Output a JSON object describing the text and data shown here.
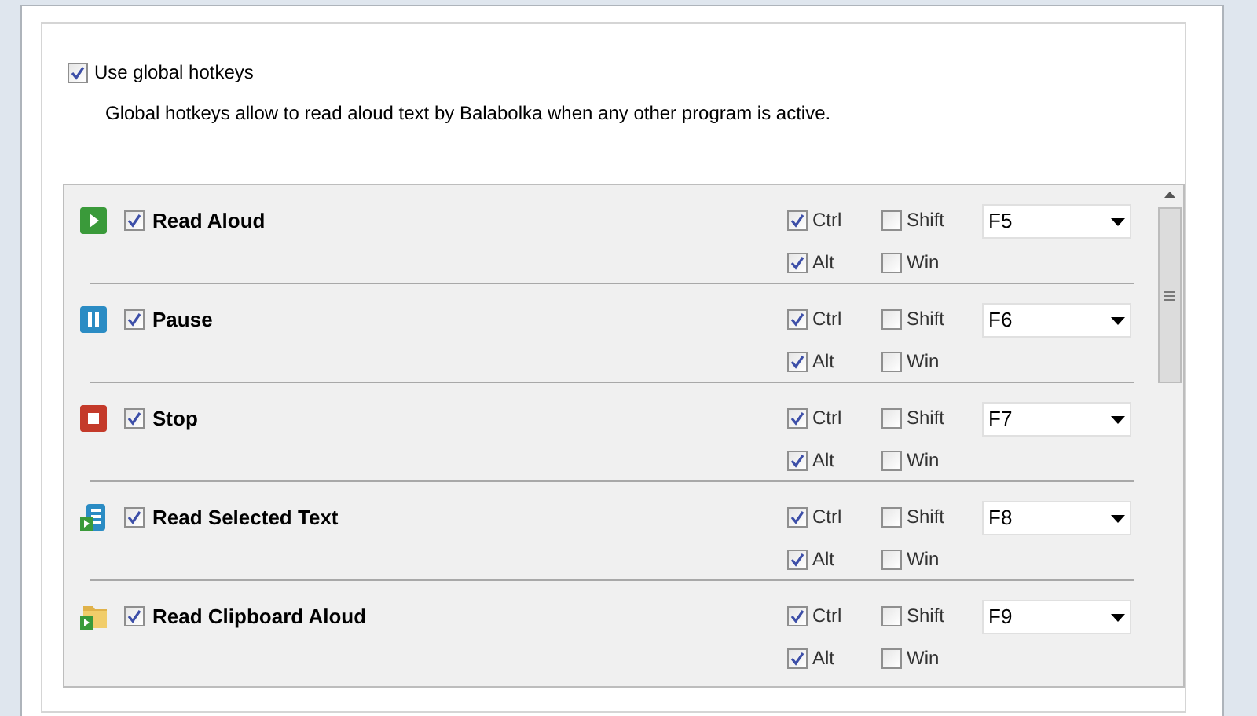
{
  "global_hotkeys": {
    "label": "Use global hotkeys",
    "checked": true
  },
  "description": "Global hotkeys allow to read aloud text by Balabolka when any other program is active.",
  "hotkeys": [
    {
      "kind": "play",
      "label": "Read Aloud",
      "checked": true,
      "modifiers": [
        {
          "label": "Ctrl",
          "checked": true
        },
        {
          "label": "Shift",
          "checked": false
        },
        {
          "label": "Alt",
          "checked": true
        },
        {
          "label": "Win",
          "checked": false
        }
      ],
      "key": "F5"
    },
    {
      "kind": "pause",
      "label": "Pause",
      "checked": true,
      "modifiers": [
        {
          "label": "Ctrl",
          "checked": true
        },
        {
          "label": "Shift",
          "checked": false
        },
        {
          "label": "Alt",
          "checked": true
        },
        {
          "label": "Win",
          "checked": false
        }
      ],
      "key": "F6"
    },
    {
      "kind": "stop",
      "label": "Stop",
      "checked": true,
      "modifiers": [
        {
          "label": "Ctrl",
          "checked": true
        },
        {
          "label": "Shift",
          "checked": false
        },
        {
          "label": "Alt",
          "checked": true
        },
        {
          "label": "Win",
          "checked": false
        }
      ],
      "key": "F7"
    },
    {
      "kind": "selected",
      "label": "Read Selected Text",
      "checked": true,
      "modifiers": [
        {
          "label": "Ctrl",
          "checked": true
        },
        {
          "label": "Shift",
          "checked": false
        },
        {
          "label": "Alt",
          "checked": true
        },
        {
          "label": "Win",
          "checked": false
        }
      ],
      "key": "F8"
    },
    {
      "kind": "clipboard",
      "label": "Read Clipboard Aloud",
      "checked": true,
      "modifiers": [
        {
          "label": "Ctrl",
          "checked": true
        },
        {
          "label": "Shift",
          "checked": false
        },
        {
          "label": "Alt",
          "checked": true
        },
        {
          "label": "Win",
          "checked": false
        }
      ],
      "key": "F9"
    }
  ]
}
